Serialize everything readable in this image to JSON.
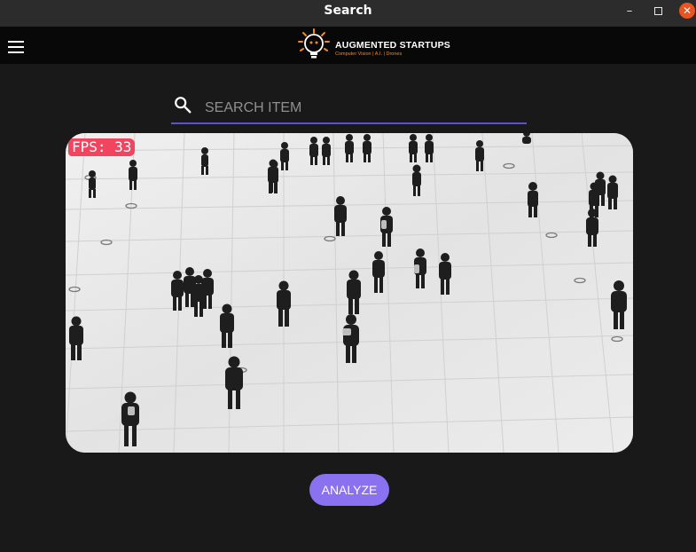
{
  "window": {
    "title": "Search",
    "minimize_icon": "minimize-icon",
    "maximize_icon": "maximize-icon",
    "close_icon": "close-icon",
    "close_color": "#e95420"
  },
  "appbar": {
    "menu_icon": "hamburger-menu-icon",
    "logo": {
      "name": "AUGMENTED STARTUPS",
      "tagline": "Computer Vision | A.I. | Drones",
      "icon": "lightbulb-robot-logo",
      "accent_color": "#f08a24"
    }
  },
  "search": {
    "placeholder": "SEARCH ITEM",
    "value": "",
    "icon": "search-icon",
    "underline_color": "#5b50d6"
  },
  "video": {
    "fps_label": "FPS: 33",
    "fps_badge_color": "#f2435f",
    "content": "overhead grayscale view of pedestrians walking on tiled plaza"
  },
  "actions": {
    "analyze_label": "ANALYZE",
    "analyze_color": "#8a71f0"
  }
}
